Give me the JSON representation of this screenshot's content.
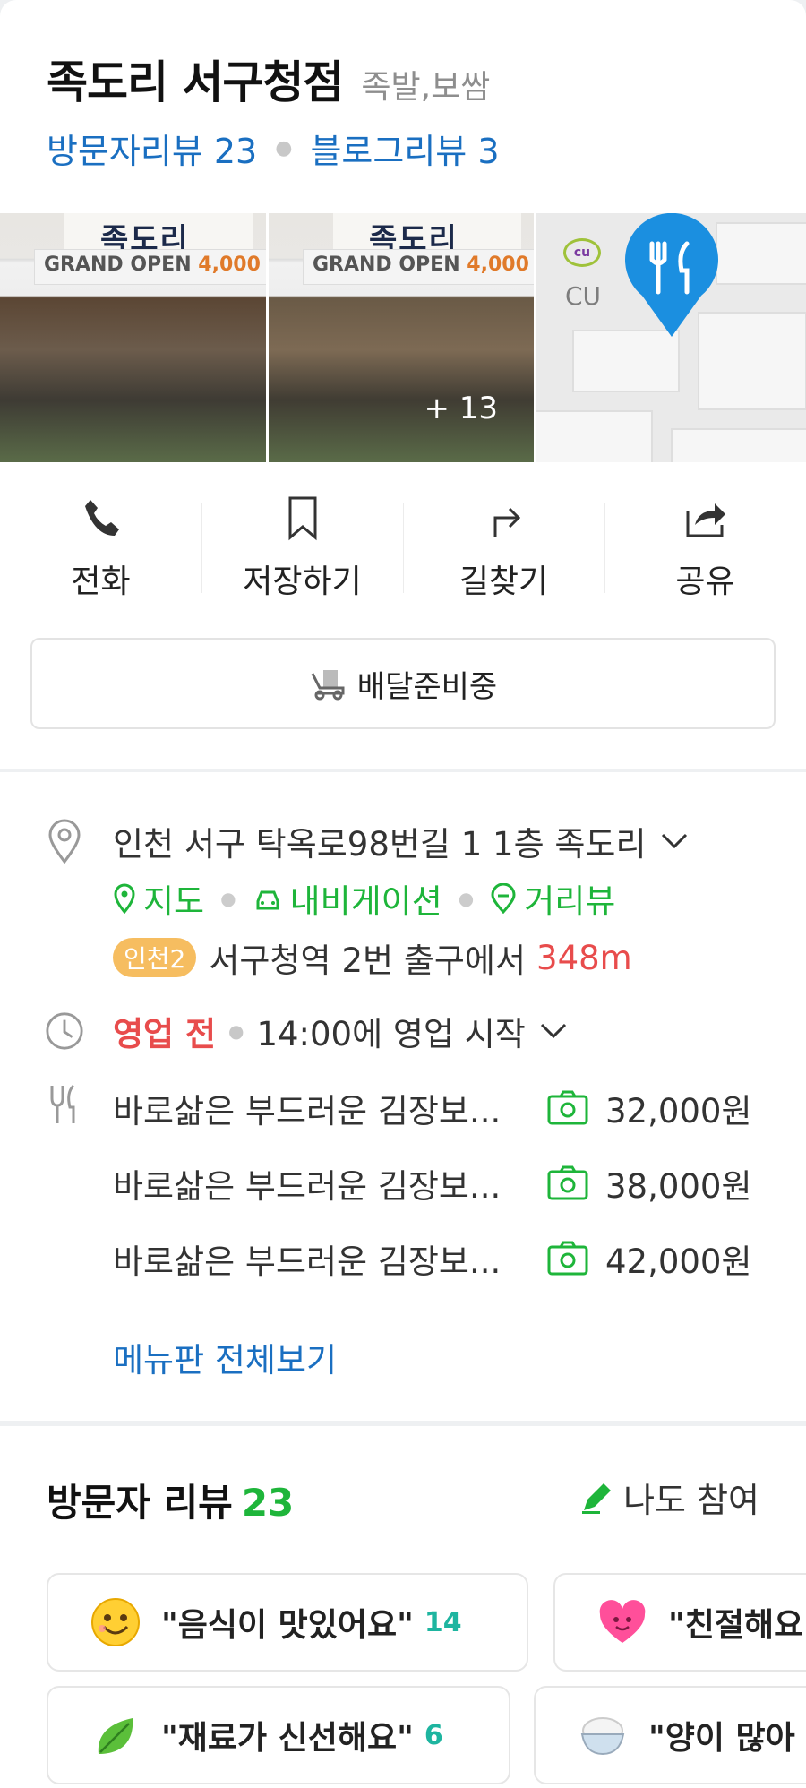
{
  "place": {
    "name": "족도리 서구청점",
    "category": "족발,보쌈",
    "visitor_reviews_label": "방문자리뷰 23",
    "blog_reviews_label": "블로그리뷰 3"
  },
  "photos": {
    "more_count": "+ 13",
    "sign_text": "족도리",
    "banner_text_prefix": "GRAND OPEN",
    "banner_text_price": "4,000",
    "map_label": "CU"
  },
  "actions": [
    {
      "label": "전화",
      "icon": "phone-icon"
    },
    {
      "label": "저장하기",
      "icon": "bookmark-icon"
    },
    {
      "label": "길찾기",
      "icon": "directions-icon"
    },
    {
      "label": "공유",
      "icon": "share-icon"
    }
  ],
  "delivery": {
    "label": "배달준비중",
    "icon": "delivery-icon"
  },
  "address": {
    "text": "인천 서구 탁옥로98번길 1 1층 족도리",
    "links": {
      "map": "지도",
      "navigation": "내비게이션",
      "street_view": "거리뷰"
    },
    "subway_line": "인천2",
    "station": "서구청역",
    "exit_text": "2번 출구에서",
    "distance": "348m"
  },
  "hours": {
    "status": "영업 전",
    "open_text": "14:00에 영업 시작"
  },
  "menu": {
    "items": [
      {
        "name": "바로삶은 부드러운 김장보...",
        "price": "32,000원"
      },
      {
        "name": "바로삶은 부드러운 김장보...",
        "price": "38,000원"
      },
      {
        "name": "바로삶은 부드러운 김장보...",
        "price": "42,000원"
      }
    ],
    "view_all": "메뉴판 전체보기"
  },
  "visitor_review": {
    "title": "방문자 리뷰",
    "count": "23",
    "join_label": "나도 참여",
    "chips": [
      {
        "text": "\"음식이 맛있어요\"",
        "count": "14",
        "icon": "smiley-icon"
      },
      {
        "text": "\"친절해요",
        "count": "",
        "icon": "heart-icon"
      },
      {
        "text": "\"재료가 신선해요\"",
        "count": "6",
        "icon": "leaf-icon"
      },
      {
        "text": "\"양이 많아",
        "count": "",
        "icon": "rice-bowl-icon"
      }
    ]
  },
  "colors": {
    "link_blue": "#1a6fc1",
    "naver_green": "#1eb53a",
    "alert_red": "#e84c4c",
    "subway_line2": "#f6bd60"
  }
}
